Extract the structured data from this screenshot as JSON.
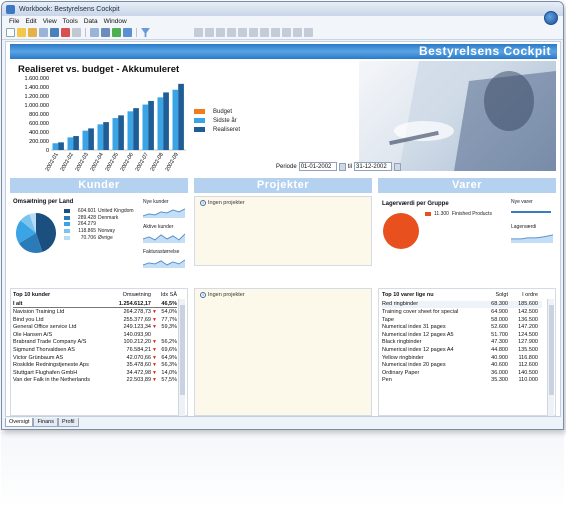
{
  "window": {
    "title": "Workbook: Bestyrelsens Cockpit"
  },
  "menu": [
    "File",
    "Edit",
    "View",
    "Tools",
    "Data",
    "Window"
  ],
  "banner": {
    "title": "Bestyrelsens Cockpit"
  },
  "main_chart": {
    "title": "Realiseret vs. budget - Akkumuleret"
  },
  "chart_data": {
    "type": "bar",
    "title": "Realiseret vs. budget - Akkumuleret",
    "categories": [
      "2002-01",
      "2002-02",
      "2002-03",
      "2002-04",
      "2002-05",
      "2002-06",
      "2002-07",
      "2002-08",
      "2002-09"
    ],
    "series": [
      {
        "name": "Budget",
        "color": "#f07c1e",
        "values": [
          0,
          0,
          0,
          0,
          0,
          0,
          0,
          0,
          0
        ]
      },
      {
        "name": "Sidste år",
        "color": "#3aa4e4",
        "values": [
          150000,
          280000,
          430000,
          570000,
          710000,
          860000,
          1010000,
          1170000,
          1340000
        ]
      },
      {
        "name": "Realiseret",
        "color": "#1f5d96",
        "values": [
          170000,
          310000,
          480000,
          620000,
          770000,
          930000,
          1090000,
          1280000,
          1470000
        ]
      }
    ],
    "ylim": [
      0,
      1600000
    ],
    "yticks": [
      "1.600.000",
      "1.400.000",
      "1.200.000",
      "1.000.000",
      "800.000",
      "600.000",
      "400.000",
      "200.000",
      "0"
    ]
  },
  "period": {
    "label": "Periode",
    "from": "01-01-2002",
    "to_label": "til",
    "to": "31-12-2002"
  },
  "sections": {
    "kunder": "Kunder",
    "projekter": "Projekter",
    "varer": "Varer"
  },
  "kunder": {
    "pie_title": "Omsætning per Land",
    "pie_legend": [
      {
        "value": "604.601",
        "country": "United Kingdom",
        "color": "#1a4f7f"
      },
      {
        "value": "289.428",
        "country": "Denmark",
        "color": "#2a7bb8"
      },
      {
        "value": "264.279",
        "country": "",
        "color": "#3aa4e4"
      },
      {
        "value": "118.865",
        "country": "Norway",
        "color": "#7cc4ee"
      },
      {
        "value": "70.706",
        "country": "Øvrige",
        "color": "#b7ddf5"
      }
    ],
    "spark_labels": [
      "Nye kunder",
      "Aktive kunder",
      "Fakturastørrelse"
    ],
    "table_title": "Top 10 kunder",
    "table_headers": [
      "Omsætning",
      "Idx SÅ"
    ],
    "table_rows": [
      {
        "name": "I alt",
        "value": "1.254.612,17",
        "idx": "46,5%",
        "bold": true
      },
      {
        "name": "Navision Training Ltd",
        "value": "264.278,73",
        "idx": "54,0%"
      },
      {
        "name": "Bind you Ltd",
        "value": "255.377,69",
        "idx": "77,7%"
      },
      {
        "name": "General Office service Ltd",
        "value": "249.123,34",
        "idx": "59,3%"
      },
      {
        "name": "Ole Hansen A/S",
        "value": "140.093,90",
        "idx": ""
      },
      {
        "name": "Brabrand Trade Company A/S",
        "value": "100.212,20",
        "idx": "56,2%"
      },
      {
        "name": "Sigmund Thorvaldsen AS",
        "value": "76.584,21",
        "idx": "69,6%"
      },
      {
        "name": "Victor Grünbaum AS",
        "value": "42.070,66",
        "idx": "64,9%"
      },
      {
        "name": "Roskilde Redningstjeneste Aps",
        "value": "35.478,60",
        "idx": "56,3%"
      },
      {
        "name": "Stuttgart Flughafen GmbH",
        "value": "34.472,98",
        "idx": "14,0%"
      },
      {
        "name": "Van der Falk in the Netherlands",
        "value": "22.503,89",
        "idx": "57,5%"
      }
    ]
  },
  "projekter": {
    "note1": "Ingen projekter",
    "note2": "Ingen projekter"
  },
  "varer": {
    "bar_title": "Lagerværdi per Gruppe",
    "bar_legend": {
      "value": "11.300",
      "label": "Finished Products"
    },
    "spark_labels": [
      "Nye varer",
      "Lagerværdi"
    ],
    "table_title": "Top 10 varer lige nu",
    "table_headers": [
      "Solgt",
      "I ordre"
    ],
    "table_rows": [
      {
        "name": "Red ringbinder",
        "sold": "68.300",
        "order": "185.600"
      },
      {
        "name": "Training cover sheet for special",
        "sold": "64.900",
        "order": "142.500"
      },
      {
        "name": "Tape",
        "sold": "58.000",
        "order": "136.500"
      },
      {
        "name": "Numerical index 31 pages",
        "sold": "52.600",
        "order": "147.200"
      },
      {
        "name": "Numerical index 12 pages A5",
        "sold": "51.700",
        "order": "124.500"
      },
      {
        "name": "Black ringbinder",
        "sold": "47.300",
        "order": "127.900"
      },
      {
        "name": "Numerical index 12 pages A4",
        "sold": "44.800",
        "order": "135.500"
      },
      {
        "name": "Yellow ringbinder",
        "sold": "40.900",
        "order": "116.800"
      },
      {
        "name": "Numerical index 20 pages",
        "sold": "40.600",
        "order": "112.600"
      },
      {
        "name": "Ordinary Paper",
        "sold": "36.000",
        "order": "140.500"
      },
      {
        "name": "Pen",
        "sold": "35.300",
        "order": "110.000"
      }
    ]
  },
  "tabs": [
    "Oversigt",
    "Finans",
    "Profil"
  ],
  "colors": {
    "banner": "#2a7ac8",
    "section": "#b4d1ef",
    "orange": "#f07c1e"
  }
}
